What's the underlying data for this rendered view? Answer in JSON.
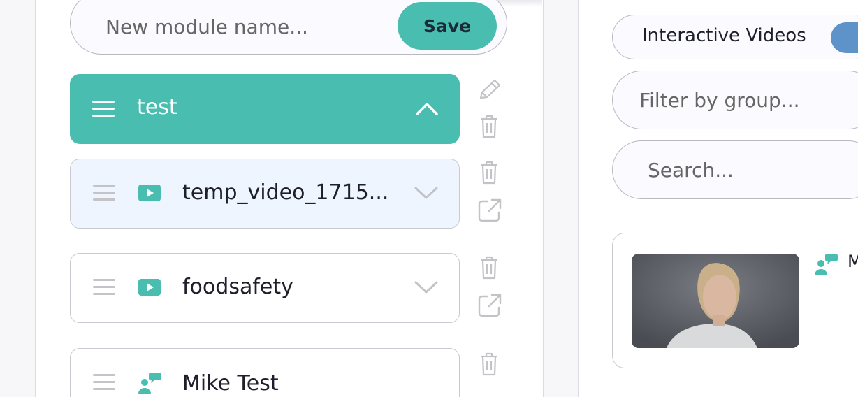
{
  "module_form": {
    "placeholder": "New module name...",
    "save_label": "Save"
  },
  "module": {
    "title": "test",
    "expanded": true
  },
  "items": [
    {
      "title": "temp_video_1715...",
      "type_icon": "video-play-icon",
      "selected": true
    },
    {
      "title": "foodsafety",
      "type_icon": "video-play-icon",
      "selected": false
    },
    {
      "title": "Mike Test",
      "type_icon": "chat-avatar-icon",
      "selected": false
    }
  ],
  "right": {
    "toggle_label": "Interactive Videos",
    "filter_placeholder": "Filter by group...",
    "search_placeholder": "Search...",
    "card_label": "M"
  },
  "colors": {
    "accent": "#49bdb0",
    "toggle": "#5d93c9",
    "selected_bg": "#eef5ff"
  }
}
